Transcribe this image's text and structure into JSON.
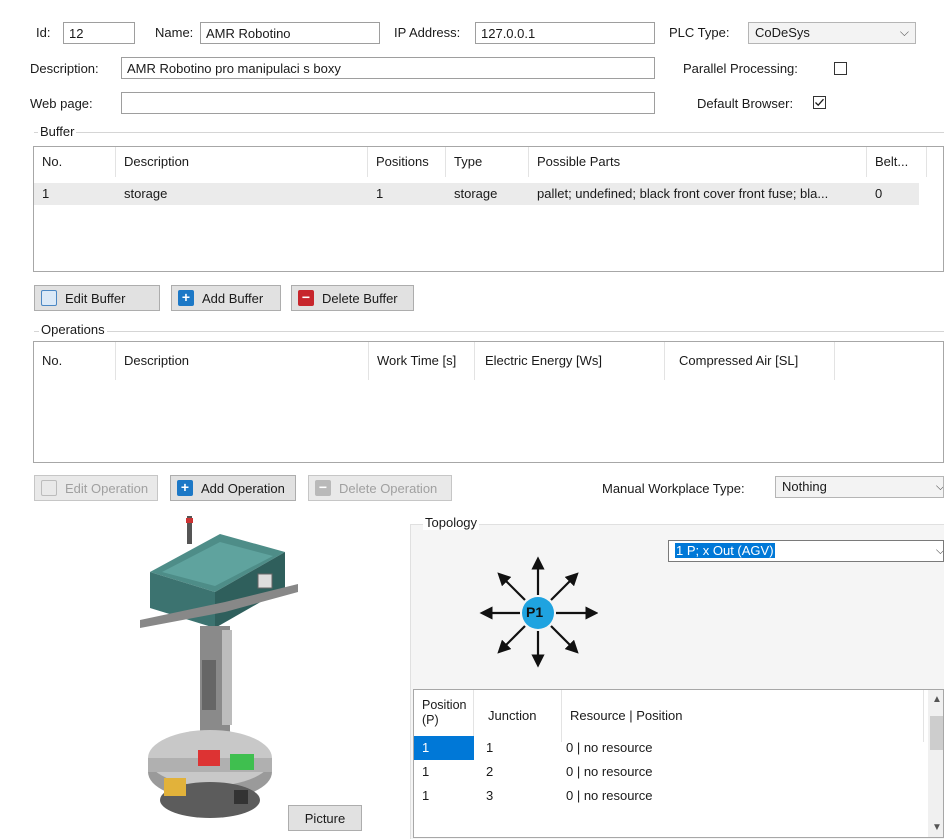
{
  "header": {
    "id_label": "Id:",
    "id_value": "12",
    "name_label": "Name:",
    "name_value": "AMR Robotino",
    "ip_label": "IP Address:",
    "ip_value": "127.0.0.1",
    "plc_label": "PLC Type:",
    "plc_value": "CoDeSys",
    "description_label": "Description:",
    "description_value": "AMR Robotino pro manipulaci s boxy",
    "parallel_label": "Parallel Processing:",
    "parallel_checked": false,
    "webpage_label": "Web page:",
    "webpage_value": "",
    "default_browser_label": "Default Browser:",
    "default_browser_checked": true
  },
  "buffer": {
    "title": "Buffer",
    "columns": [
      "No.",
      "Description",
      "Positions",
      "Type",
      "Possible Parts",
      "Belt..."
    ],
    "rows": [
      [
        "1",
        "storage",
        "1",
        "storage",
        "pallet; undefined; black front cover front fuse; bla...",
        "0"
      ]
    ],
    "edit_label": "Edit Buffer",
    "add_label": "Add Buffer",
    "delete_label": "Delete Buffer"
  },
  "operations": {
    "title": "Operations",
    "columns": [
      "No.",
      "Description",
      "Work Time [s]",
      "Electric Energy [Ws]",
      "Compressed Air [SL]"
    ],
    "edit_label": "Edit Operation",
    "add_label": "Add Operation",
    "delete_label": "Delete Operation"
  },
  "manual_workplace": {
    "label": "Manual Workplace Type:",
    "value": "Nothing"
  },
  "topology": {
    "title": "Topology",
    "selected": "1 P; x Out (AGV)",
    "node_label": "P1",
    "columns": [
      "Position (P)",
      "Junction",
      "Resource | Position"
    ],
    "rows": [
      [
        "1",
        "1",
        "0 | no resource"
      ],
      [
        "1",
        "2",
        "0 | no resource"
      ],
      [
        "1",
        "3",
        "0 | no resource"
      ]
    ]
  },
  "picture_button": "Picture",
  "colors": {
    "accent_blue": "#1c78c6",
    "delete_red": "#c7262c",
    "selection_blue": "#0078d7",
    "topology_node": "#1fa3e0"
  }
}
